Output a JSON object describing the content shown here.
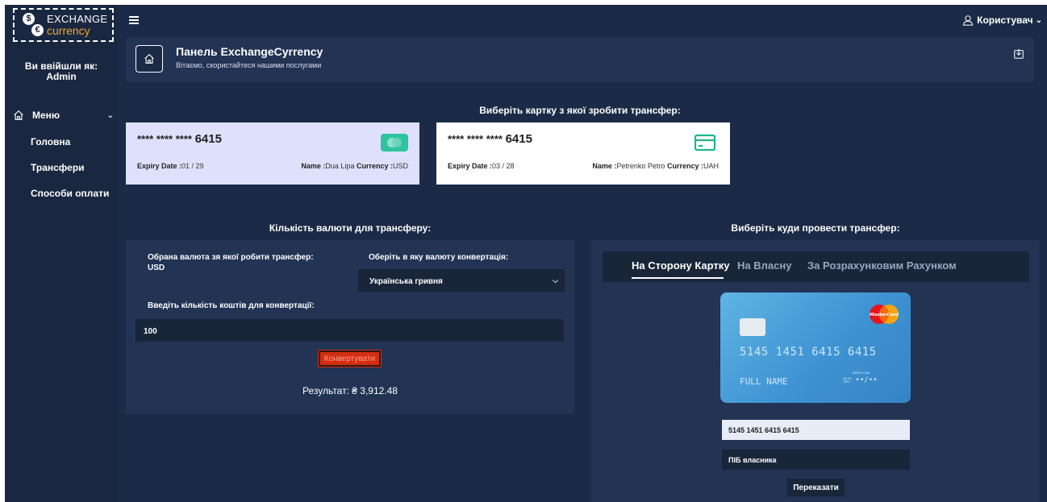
{
  "logo": {
    "line1": "EXCHANGE",
    "line2": "currency",
    "mark1": "$",
    "mark2": "€"
  },
  "sidebar": {
    "login_label": "Ви ввійшли як:",
    "login_user": "Admin",
    "menu_label": "Меню",
    "items": [
      {
        "label": "Головна"
      },
      {
        "label": "Трансфери"
      },
      {
        "label": "Способи оплати"
      }
    ]
  },
  "topbar": {
    "user_label": "Користувач"
  },
  "header": {
    "title": "Панель ExchangeCyrrency",
    "subtitle": "Вітаємо, скористайтеся нашими послугами"
  },
  "cards_section": {
    "title": "Виберіть картку з якої зробити трансфер:",
    "cards": [
      {
        "masked": "**** **** ****",
        "last4": "6415",
        "expiry_label": "Expiry Date :",
        "expiry": "01 / 29",
        "name_label": "Name :",
        "name": "Dua Lipa",
        "currency_label": "Currency :",
        "currency": "USD",
        "brand_icon": "mastercard-icon"
      },
      {
        "masked": "**** **** ****",
        "last4": "6415",
        "expiry_label": "Expiry Date :",
        "expiry": "03 / 28",
        "name_label": "Name :",
        "name": "Petrenko Petro",
        "currency_label": "Currency :",
        "currency": "UAH",
        "brand_icon": "credit-card-icon"
      }
    ]
  },
  "converter": {
    "title": "Кількість валюти для трансферу:",
    "source_label": "Обрана валюта зя якої робити трансфер:",
    "source_value": "USD",
    "target_label": "Оберіть в яку валюту конвертація:",
    "target_selected": "Українська гривня",
    "amount_label": "Введіть кількість коштів для конвертації:",
    "amount_value": "100",
    "convert_button": "Конвертувати",
    "result_text": "Результат: ₴ 3,912.48"
  },
  "destination": {
    "title": "Виберіть куди провести трансфер:",
    "tabs": [
      {
        "label": "На Сторону Картку",
        "active": true
      },
      {
        "label": "На Власну",
        "active": false
      },
      {
        "label": "За Розрахунковим Рахунком",
        "active": false
      }
    ],
    "card_preview": {
      "number": "5145 1451 6415 6415",
      "name": "FULL NAME",
      "expiry_caption": "MONTH/YEAR",
      "valid_caption": "VALID THRU",
      "expiry": "••/••",
      "brand": "MasterCard"
    },
    "card_number_value": "5145 1451 6415 6415",
    "owner_placeholder": "ПІБ власника",
    "transfer_button": "Переказати"
  },
  "colors": {
    "background": "#1b2a46",
    "panel": "#223354",
    "input": "#192539",
    "accent_orange": "#f5a623",
    "convert_red": "#d42d10",
    "selected_card": "#dfe0fb"
  }
}
